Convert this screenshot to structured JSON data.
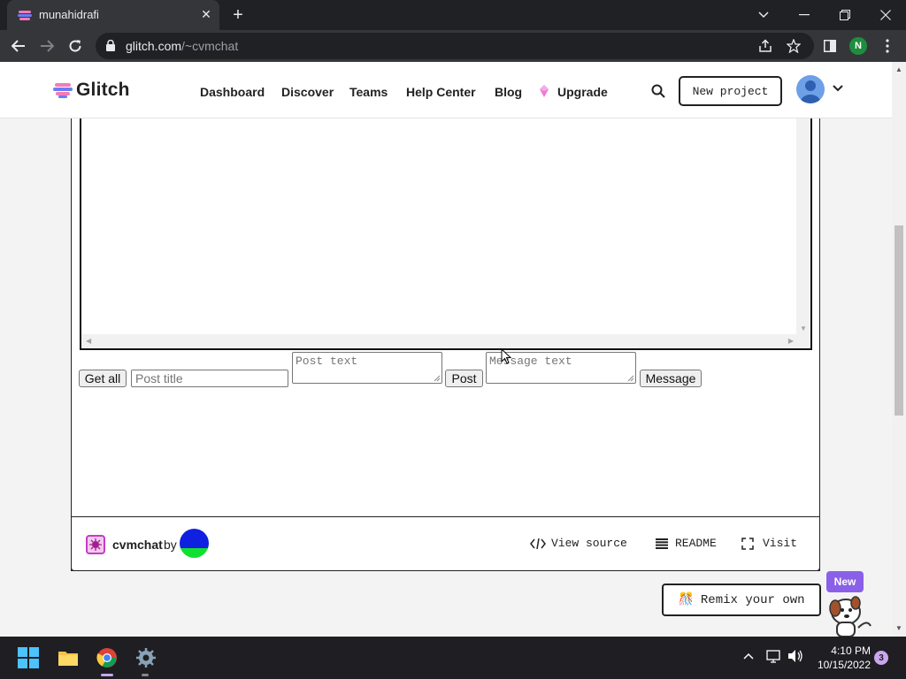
{
  "browser": {
    "tab_title": "munahidrafi",
    "new_tab": "+",
    "url_host": "glitch.com",
    "url_path": "/~cvmchat",
    "profile_initial": "N"
  },
  "header": {
    "logo_text": "Glitch",
    "nav": {
      "dashboard": "Dashboard",
      "discover": "Discover",
      "teams": "Teams",
      "help": "Help Center",
      "blog": "Blog",
      "upgrade": "Upgrade"
    },
    "new_project": "New project"
  },
  "app": {
    "get_all": "Get all",
    "post_title_placeholder": "Post title",
    "post_text_placeholder": "Post text",
    "post": "Post",
    "message_text_placeholder": "Message text",
    "message": "Message"
  },
  "footer": {
    "project_name": "cvmchat",
    "by": "by",
    "view_source": "View source",
    "readme": "README",
    "visit": "Visit"
  },
  "remix": {
    "label": "Remix your own",
    "emoji": "🎊",
    "new_badge": "New"
  },
  "taskbar": {
    "time": "4:10 PM",
    "date": "10/15/2022",
    "notifications": "3"
  },
  "colors": {
    "chrome_dark": "#202124",
    "chrome_toolbar": "#35363a",
    "accent_purple": "#8a60e8",
    "upgrade_gem": "#f07ad8"
  }
}
